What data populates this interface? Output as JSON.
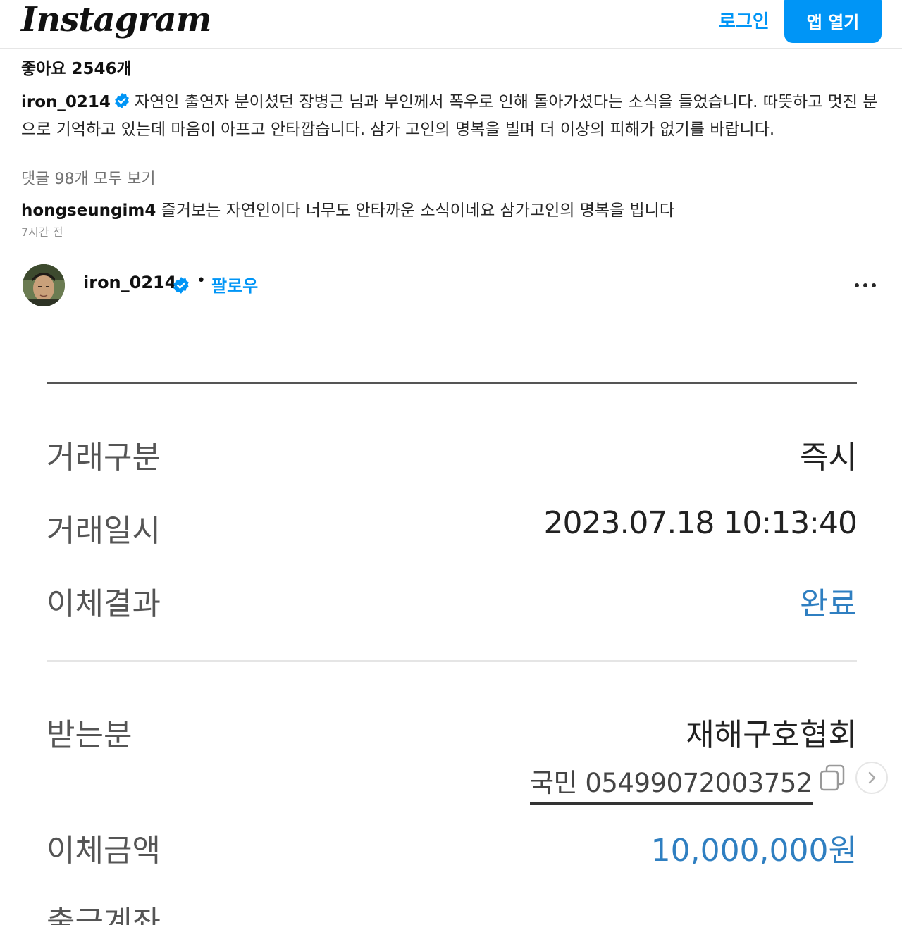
{
  "header": {
    "logo": "Instagram",
    "login_label": "로그인",
    "open_app_label": "앱 열기"
  },
  "post": {
    "likes": "좋아요 2546개",
    "caption_user": "iron_0214",
    "caption_text": "자연인 출연자 분이셨던 장병근 님과 부인께서 폭우로 인해 돌아가셨다는 소식을 들었습니다. 따뜻하고 멋진 분으로 기억하고 있는데 마음이 아프고 안타깝습니다. 삼가 고인의 명복을 빌며 더 이상의 피해가 없기를 바랍니다.",
    "view_comments": "댓글 98개 모두 보기",
    "comment_user": "hongseungim4",
    "comment_text": "즐거보는 자연인이다 너무도 안타까운 소식이네요 삼가고인의 명복을 빕니다",
    "comment_time": "7시간 전"
  },
  "author": {
    "username": "iron_0214",
    "separator": "•",
    "follow_label": "팔로우"
  },
  "receipt": {
    "rows": [
      {
        "label": "거래구분",
        "value": "즉시"
      },
      {
        "label": "거래일시",
        "value": "2023.07.18 10:13:40"
      },
      {
        "label": "이체결과",
        "value": "완료"
      },
      {
        "label": "받는분",
        "value": "재해구호협회"
      },
      {
        "label": "이체금액",
        "value": "10,000,000원"
      }
    ],
    "account": "국민 05499072003752",
    "partial_label": "출금계좌"
  },
  "colors": {
    "accent": "#0095f6",
    "receipt_blue": "#2f7fc1"
  },
  "icons": {
    "verified": "verified-badge-icon",
    "more": "more-horizontal-icon",
    "copy": "copy-icon",
    "next": "chevron-right-icon"
  }
}
